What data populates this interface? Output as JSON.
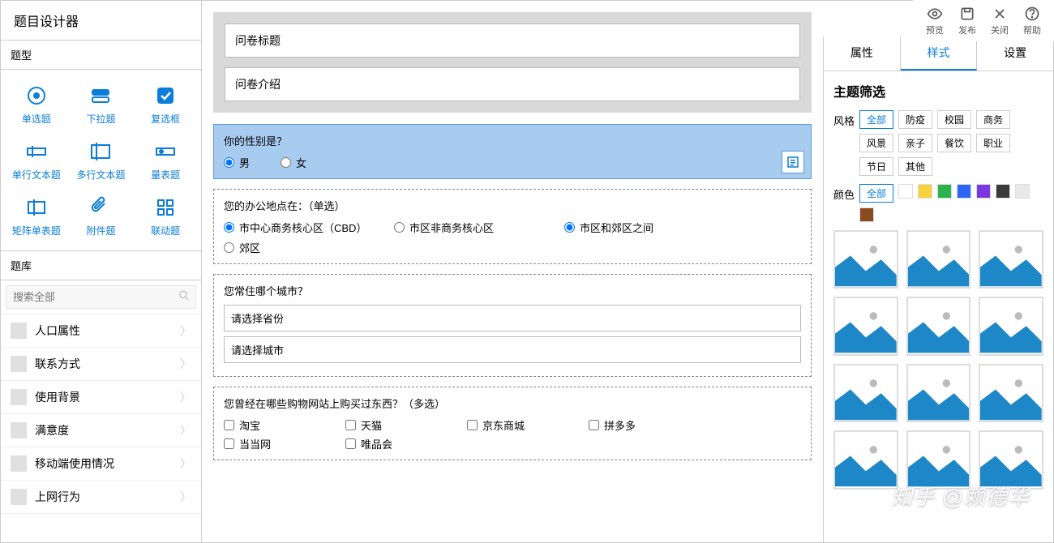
{
  "app": {
    "title": "题目设计器"
  },
  "toolbar": {
    "preview": "预览",
    "publish": "发布",
    "close": "关闭",
    "help": "帮助"
  },
  "left": {
    "qtype_header": "题型",
    "qtypes": [
      {
        "label": "单选题"
      },
      {
        "label": "下拉题"
      },
      {
        "label": "复选框"
      },
      {
        "label": "单行文本题"
      },
      {
        "label": "多行文本题"
      },
      {
        "label": "量表题"
      },
      {
        "label": "矩阵单表题"
      },
      {
        "label": "附件题"
      },
      {
        "label": "联动题"
      }
    ],
    "lib_header": "题库",
    "search_placeholder": "搜索全部",
    "lib_items": [
      {
        "label": "人口属性"
      },
      {
        "label": "联系方式"
      },
      {
        "label": "使用背景"
      },
      {
        "label": "满意度"
      },
      {
        "label": "移动端使用情况"
      },
      {
        "label": "上网行为"
      }
    ]
  },
  "center": {
    "survey_title_placeholder": "问卷标题",
    "survey_intro_placeholder": "问卷介绍",
    "q1": {
      "title": "你的性别是？",
      "opts": [
        "男",
        "女"
      ]
    },
    "q2": {
      "title": "您的办公地点在：（单选）",
      "opts": [
        "市中心商务核心区（CBD）",
        "市区非商务核心区",
        "市区和郊区之间",
        "郊区"
      ]
    },
    "q3": {
      "title": "您常住哪个城市？",
      "sel1": "请选择省份",
      "sel2": "请选择城市"
    },
    "q4": {
      "title": "您曾经在哪些购物网站上购买过东西？（多选）",
      "opts": [
        "淘宝",
        "天猫",
        "京东商城",
        "拼多多",
        "当当网",
        "唯品会"
      ]
    }
  },
  "right": {
    "tabs": [
      "属性",
      "样式",
      "设置"
    ],
    "active_tab": 1,
    "panel_title": "主题筛选",
    "style_label": "风格",
    "color_label": "颜色",
    "style_tags": [
      "全部",
      "防疫",
      "校园",
      "商务",
      "风景",
      "亲子",
      "餐饮",
      "职业",
      "节日",
      "其他"
    ],
    "color_all": "全部",
    "swatches": [
      "#f05b4f",
      "#f7d23e",
      "#2bb24c",
      "#2d66f6",
      "#7a39e0",
      "#3a3a3a",
      "#e8e8e8",
      "#8a4b1f"
    ]
  },
  "watermark": "知乎 @赖德华"
}
